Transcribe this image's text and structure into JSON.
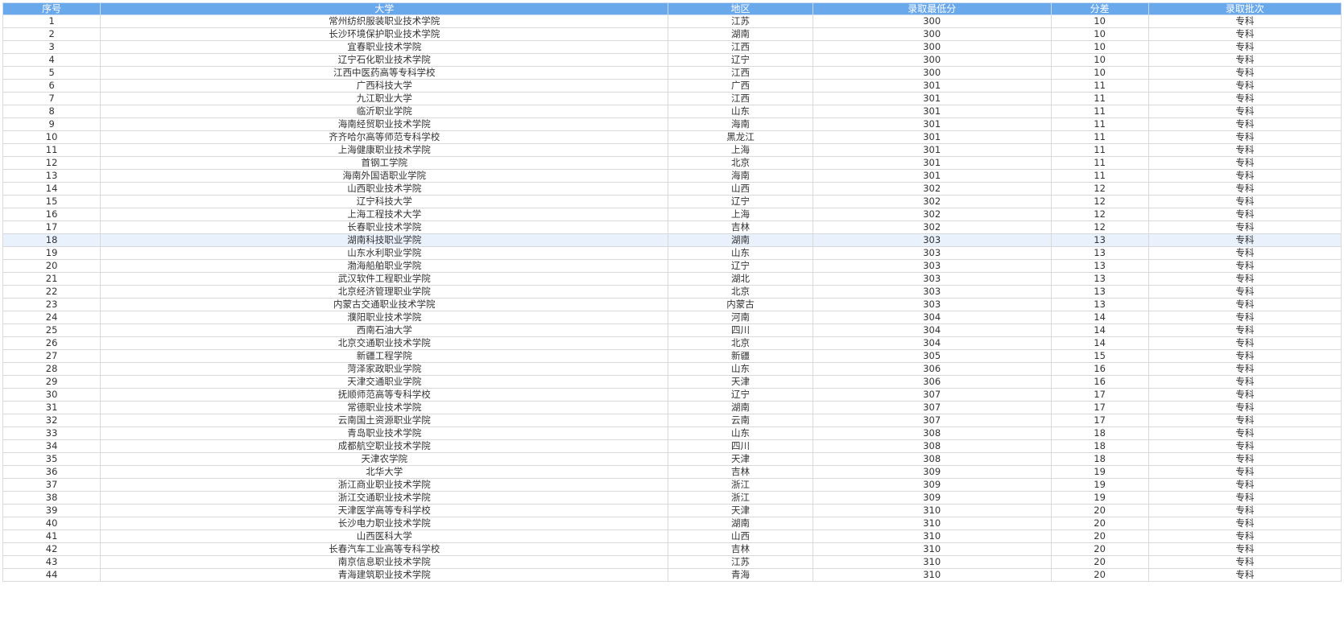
{
  "headers": [
    "序号",
    "大学",
    "地区",
    "录取最低分",
    "分差",
    "录取批次"
  ],
  "highlighted_row_index": 17,
  "colors": {
    "header_bg": "#6aa8ec",
    "header_text": "#ffffff",
    "highlight_row": "#e8f1fc",
    "grid": "#d9d9d9"
  },
  "rows": [
    [
      "1",
      "常州纺织服装职业技术学院",
      "江苏",
      "300",
      "10",
      "专科"
    ],
    [
      "2",
      "长沙环境保护职业技术学院",
      "湖南",
      "300",
      "10",
      "专科"
    ],
    [
      "3",
      "宜春职业技术学院",
      "江西",
      "300",
      "10",
      "专科"
    ],
    [
      "4",
      "辽宁石化职业技术学院",
      "辽宁",
      "300",
      "10",
      "专科"
    ],
    [
      "5",
      "江西中医药高等专科学校",
      "江西",
      "300",
      "10",
      "专科"
    ],
    [
      "6",
      "广西科技大学",
      "广西",
      "301",
      "11",
      "专科"
    ],
    [
      "7",
      "九江职业大学",
      "江西",
      "301",
      "11",
      "专科"
    ],
    [
      "8",
      "临沂职业学院",
      "山东",
      "301",
      "11",
      "专科"
    ],
    [
      "9",
      "海南经贸职业技术学院",
      "海南",
      "301",
      "11",
      "专科"
    ],
    [
      "10",
      "齐齐哈尔高等师范专科学校",
      "黑龙江",
      "301",
      "11",
      "专科"
    ],
    [
      "11",
      "上海健康职业技术学院",
      "上海",
      "301",
      "11",
      "专科"
    ],
    [
      "12",
      "首钢工学院",
      "北京",
      "301",
      "11",
      "专科"
    ],
    [
      "13",
      "海南外国语职业学院",
      "海南",
      "301",
      "11",
      "专科"
    ],
    [
      "14",
      "山西职业技术学院",
      "山西",
      "302",
      "12",
      "专科"
    ],
    [
      "15",
      "辽宁科技大学",
      "辽宁",
      "302",
      "12",
      "专科"
    ],
    [
      "16",
      "上海工程技术大学",
      "上海",
      "302",
      "12",
      "专科"
    ],
    [
      "17",
      "长春职业技术学院",
      "吉林",
      "302",
      "12",
      "专科"
    ],
    [
      "18",
      "湖南科技职业学院",
      "湖南",
      "303",
      "13",
      "专科"
    ],
    [
      "19",
      "山东水利职业学院",
      "山东",
      "303",
      "13",
      "专科"
    ],
    [
      "20",
      "渤海船舶职业学院",
      "辽宁",
      "303",
      "13",
      "专科"
    ],
    [
      "21",
      "武汉软件工程职业学院",
      "湖北",
      "303",
      "13",
      "专科"
    ],
    [
      "22",
      "北京经济管理职业学院",
      "北京",
      "303",
      "13",
      "专科"
    ],
    [
      "23",
      "内蒙古交通职业技术学院",
      "内蒙古",
      "303",
      "13",
      "专科"
    ],
    [
      "24",
      "濮阳职业技术学院",
      "河南",
      "304",
      "14",
      "专科"
    ],
    [
      "25",
      "西南石油大学",
      "四川",
      "304",
      "14",
      "专科"
    ],
    [
      "26",
      "北京交通职业技术学院",
      "北京",
      "304",
      "14",
      "专科"
    ],
    [
      "27",
      "新疆工程学院",
      "新疆",
      "305",
      "15",
      "专科"
    ],
    [
      "28",
      "菏泽家政职业学院",
      "山东",
      "306",
      "16",
      "专科"
    ],
    [
      "29",
      "天津交通职业学院",
      "天津",
      "306",
      "16",
      "专科"
    ],
    [
      "30",
      "抚顺师范高等专科学校",
      "辽宁",
      "307",
      "17",
      "专科"
    ],
    [
      "31",
      "常德职业技术学院",
      "湖南",
      "307",
      "17",
      "专科"
    ],
    [
      "32",
      "云南国土资源职业学院",
      "云南",
      "307",
      "17",
      "专科"
    ],
    [
      "33",
      "青岛职业技术学院",
      "山东",
      "308",
      "18",
      "专科"
    ],
    [
      "34",
      "成都航空职业技术学院",
      "四川",
      "308",
      "18",
      "专科"
    ],
    [
      "35",
      "天津农学院",
      "天津",
      "308",
      "18",
      "专科"
    ],
    [
      "36",
      "北华大学",
      "吉林",
      "309",
      "19",
      "专科"
    ],
    [
      "37",
      "浙江商业职业技术学院",
      "浙江",
      "309",
      "19",
      "专科"
    ],
    [
      "38",
      "浙江交通职业技术学院",
      "浙江",
      "309",
      "19",
      "专科"
    ],
    [
      "39",
      "天津医学高等专科学校",
      "天津",
      "310",
      "20",
      "专科"
    ],
    [
      "40",
      "长沙电力职业技术学院",
      "湖南",
      "310",
      "20",
      "专科"
    ],
    [
      "41",
      "山西医科大学",
      "山西",
      "310",
      "20",
      "专科"
    ],
    [
      "42",
      "长春汽车工业高等专科学校",
      "吉林",
      "310",
      "20",
      "专科"
    ],
    [
      "43",
      "南京信息职业技术学院",
      "江苏",
      "310",
      "20",
      "专科"
    ],
    [
      "44",
      "青海建筑职业技术学院",
      "青海",
      "310",
      "20",
      "专科"
    ]
  ]
}
